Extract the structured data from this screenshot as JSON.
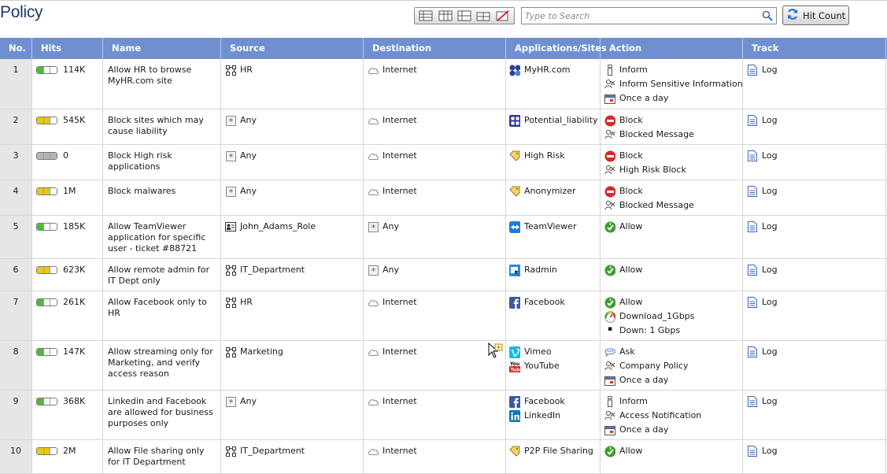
{
  "page": {
    "title": "Policy"
  },
  "toolbar": {
    "search_placeholder": "Type to Search",
    "hit_count_label": "Hit Count"
  },
  "columns": [
    "No.",
    "Hits",
    "Name",
    "Source",
    "Destination",
    "Applications/Sites",
    "Action",
    "Track"
  ],
  "colors": {
    "header": "#6f8fd0",
    "hits_green": "#53b83a",
    "hits_yellow": "#e7c819",
    "hits_gray": "#b4b4b4",
    "block_red": "#d32a2a",
    "allow_green": "#3c9c2e"
  },
  "rules": [
    {
      "no": "1",
      "hits": {
        "value": "114K",
        "level": 1,
        "color": "green"
      },
      "name": "Allow HR to browse MyHR.com site",
      "source": [
        {
          "icon": "network-group-icon",
          "text": "HR"
        }
      ],
      "destination": [
        {
          "icon": "internet-cloud-icon",
          "text": "Internet"
        }
      ],
      "apps": [
        {
          "icon": "myhr-app-icon",
          "text": "MyHR.com"
        }
      ],
      "action": [
        {
          "icon": "inform-icon",
          "text": "Inform"
        },
        {
          "icon": "user-check-icon",
          "text": "Inform Sensitive Information"
        },
        {
          "icon": "calendar-icon",
          "text": "Once a day"
        }
      ],
      "track": [
        {
          "icon": "log-icon",
          "text": "Log"
        }
      ]
    },
    {
      "no": "2",
      "hits": {
        "value": "545K",
        "level": 2,
        "color": "yellow"
      },
      "name": "Block sites which may cause liability",
      "source": [
        {
          "icon": "any-icon",
          "text": "Any"
        }
      ],
      "destination": [
        {
          "icon": "internet-cloud-icon",
          "text": "Internet"
        }
      ],
      "apps": [
        {
          "icon": "category-grid-icon",
          "text": "Potential_liability"
        }
      ],
      "action": [
        {
          "icon": "block-icon",
          "text": "Block"
        },
        {
          "icon": "user-check-icon",
          "text": "Blocked Message"
        }
      ],
      "track": [
        {
          "icon": "log-icon",
          "text": "Log"
        }
      ]
    },
    {
      "no": "3",
      "hits": {
        "value": "0",
        "level": 0,
        "color": "gray"
      },
      "name": "Block High risk applications",
      "source": [
        {
          "icon": "any-icon",
          "text": "Any"
        }
      ],
      "destination": [
        {
          "icon": "internet-cloud-icon",
          "text": "Internet"
        }
      ],
      "apps": [
        {
          "icon": "tag-icon",
          "text": "High Risk"
        }
      ],
      "action": [
        {
          "icon": "block-icon",
          "text": "Block"
        },
        {
          "icon": "user-check-icon",
          "text": "High Risk Block"
        }
      ],
      "track": [
        {
          "icon": "log-icon",
          "text": "Log"
        }
      ]
    },
    {
      "no": "4",
      "hits": {
        "value": "1M",
        "level": 2,
        "color": "yellow"
      },
      "name": "Block malwares",
      "source": [
        {
          "icon": "any-icon",
          "text": "Any"
        }
      ],
      "destination": [
        {
          "icon": "internet-cloud-icon",
          "text": "Internet"
        }
      ],
      "apps": [
        {
          "icon": "tag-icon",
          "text": "Anonymizer"
        }
      ],
      "action": [
        {
          "icon": "block-icon",
          "text": "Block"
        },
        {
          "icon": "user-check-icon",
          "text": "Blocked Message"
        }
      ],
      "track": [
        {
          "icon": "log-icon",
          "text": "Log"
        }
      ]
    },
    {
      "no": "5",
      "hits": {
        "value": "185K",
        "level": 1,
        "color": "green"
      },
      "name": "Allow TeamViewer application for specific user - ticket #88721",
      "source": [
        {
          "icon": "access-role-icon",
          "text": "John_Adams_Role"
        }
      ],
      "destination": [
        {
          "icon": "any-icon",
          "text": "Any"
        }
      ],
      "apps": [
        {
          "icon": "teamviewer-icon",
          "text": "TeamViewer"
        }
      ],
      "action": [
        {
          "icon": "allow-icon",
          "text": "Allow"
        }
      ],
      "track": [
        {
          "icon": "log-icon",
          "text": "Log"
        }
      ]
    },
    {
      "no": "6",
      "hits": {
        "value": "623K",
        "level": 2,
        "color": "yellow"
      },
      "name": "Allow remote admin for IT Dept only",
      "source": [
        {
          "icon": "network-group-icon",
          "text": "IT_Department"
        }
      ],
      "destination": [
        {
          "icon": "any-icon",
          "text": "Any"
        }
      ],
      "apps": [
        {
          "icon": "radmin-icon",
          "text": "Radmin"
        }
      ],
      "action": [
        {
          "icon": "allow-icon",
          "text": "Allow"
        }
      ],
      "track": [
        {
          "icon": "log-icon",
          "text": "Log"
        }
      ]
    },
    {
      "no": "7",
      "hits": {
        "value": "261K",
        "level": 1,
        "color": "green"
      },
      "name": "Allow Facebook only to HR",
      "source": [
        {
          "icon": "network-group-icon",
          "text": "HR"
        }
      ],
      "destination": [
        {
          "icon": "internet-cloud-icon",
          "text": "Internet"
        }
      ],
      "apps": [
        {
          "icon": "facebook-icon",
          "text": "Facebook"
        }
      ],
      "action": [
        {
          "icon": "allow-icon",
          "text": "Allow"
        },
        {
          "icon": "gauge-icon",
          "text": "Download_1Gbps"
        },
        {
          "icon": "bullet",
          "text": "Down: 1 Gbps"
        }
      ],
      "track": [
        {
          "icon": "log-icon",
          "text": "Log"
        }
      ]
    },
    {
      "no": "8",
      "hits": {
        "value": "147K",
        "level": 1,
        "color": "green"
      },
      "name": "Allow streaming only for Marketing, and verify access reason",
      "source": [
        {
          "icon": "network-group-icon",
          "text": "Marketing"
        }
      ],
      "destination": [
        {
          "icon": "internet-cloud-icon",
          "text": "Internet"
        }
      ],
      "apps": [
        {
          "icon": "vimeo-icon",
          "text": "Vimeo"
        },
        {
          "icon": "youtube-icon",
          "text": "YouTube"
        }
      ],
      "action": [
        {
          "icon": "ask-icon",
          "text": "Ask"
        },
        {
          "icon": "user-check-icon",
          "text": "Company Policy"
        },
        {
          "icon": "calendar-icon",
          "text": "Once a day"
        }
      ],
      "track": [
        {
          "icon": "log-icon",
          "text": "Log"
        }
      ]
    },
    {
      "no": "9",
      "hits": {
        "value": "368K",
        "level": 1,
        "color": "green"
      },
      "name": "Linkedin and Facebook are allowed for business purposes only",
      "source": [
        {
          "icon": "any-icon",
          "text": "Any"
        }
      ],
      "destination": [
        {
          "icon": "internet-cloud-icon",
          "text": "Internet"
        }
      ],
      "apps": [
        {
          "icon": "facebook-icon",
          "text": "Facebook"
        },
        {
          "icon": "linkedin-icon",
          "text": "LinkedIn"
        }
      ],
      "action": [
        {
          "icon": "inform-icon",
          "text": "Inform"
        },
        {
          "icon": "user-check-icon",
          "text": "Access Notification"
        },
        {
          "icon": "calendar-icon",
          "text": "Once a day"
        }
      ],
      "track": [
        {
          "icon": "log-icon",
          "text": "Log"
        }
      ]
    },
    {
      "no": "10",
      "hits": {
        "value": "2M",
        "level": 2,
        "color": "yellow"
      },
      "name": "Allow File sharing only for IT Department",
      "source": [
        {
          "icon": "network-group-icon",
          "text": "IT_Department"
        }
      ],
      "destination": [
        {
          "icon": "internet-cloud-icon",
          "text": "Internet"
        }
      ],
      "apps": [
        {
          "icon": "tag-icon",
          "text": "P2P File Sharing"
        }
      ],
      "action": [
        {
          "icon": "allow-icon",
          "text": "Allow"
        }
      ],
      "track": [
        {
          "icon": "log-icon",
          "text": "Log"
        }
      ]
    }
  ]
}
